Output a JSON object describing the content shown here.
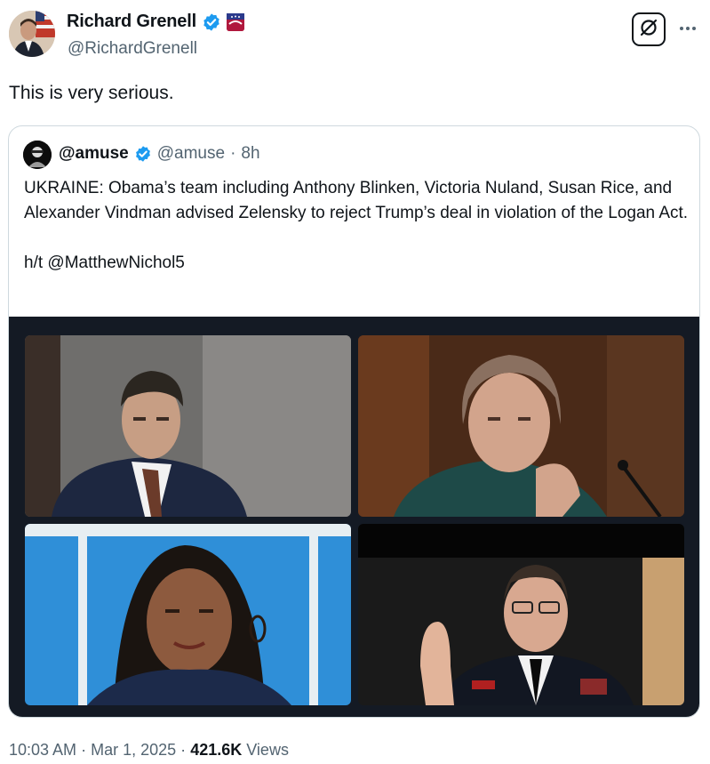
{
  "author": {
    "display_name": "Richard Grenell",
    "handle": "@RichardGrenell",
    "verified_badge": "blue-check-icon",
    "affiliate_badge": "org-affiliate-badge-icon"
  },
  "tweet": {
    "text": "This is very serious."
  },
  "quoted_tweet": {
    "display_name": "@amuse",
    "handle": "@amuse",
    "separator": "·",
    "time": "8h",
    "body_line1": "UKRAINE: Obama’s team including Anthony Blinken, Victoria Nuland, Susan Rice, and Alexander Vindman advised Zelensky to reject Trump’s deal in violation of the Logan Act.",
    "body_line2": "h/t @MatthewNichol5",
    "photos": [
      "photo-blinken",
      "photo-nuland",
      "photo-rice",
      "photo-vindman"
    ]
  },
  "meta": {
    "time": "10:03 AM",
    "separator": "·",
    "date": "Mar 1, 2025",
    "separator2": "·",
    "views_count": "421.6K",
    "views_label": "Views"
  },
  "colors": {
    "text": "#0f1419",
    "secondary": "#536471",
    "verified": "#1d9bf0",
    "border": "#cfd9de",
    "media_bg": "#141a24"
  }
}
